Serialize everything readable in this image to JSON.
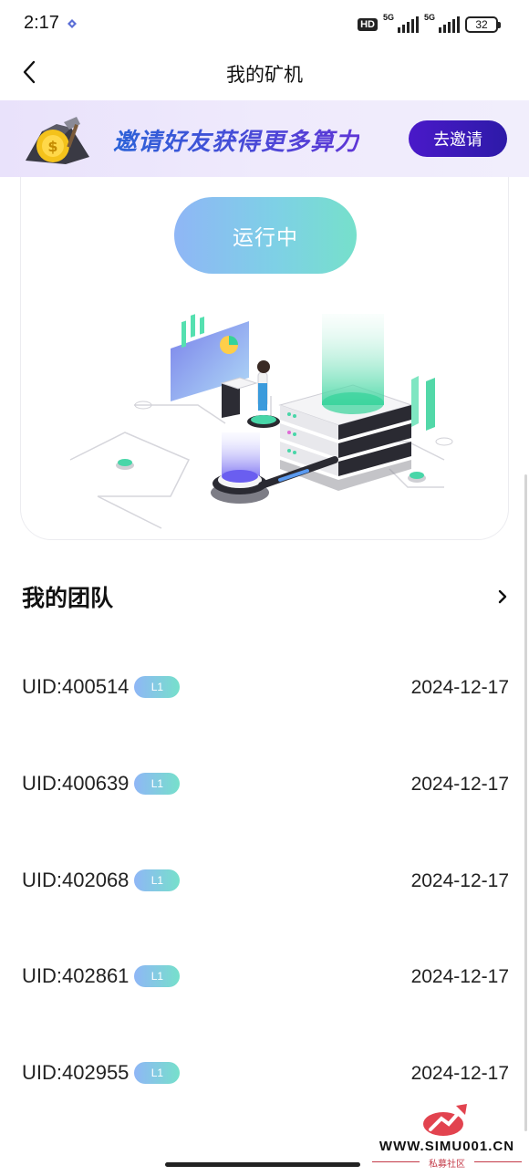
{
  "status_bar": {
    "time": "2:17",
    "hd_label": "HD",
    "network_1": "5G",
    "network_2": "5G",
    "battery": "32"
  },
  "nav": {
    "title": "我的矿机",
    "back_icon": "chevron-left-icon"
  },
  "banner": {
    "text": "邀请好友获得更多算力",
    "button_label": "去邀请",
    "colors": {
      "text": "#3b3ad6",
      "button": "#3a1bbd"
    }
  },
  "miner": {
    "status_label": "运行中",
    "status_color": "#7ed0e6"
  },
  "team": {
    "title": "我的团队",
    "arrow_icon": "chevron-right-icon",
    "members": [
      {
        "uid": "UID:400514",
        "level": "L1",
        "date": "2024-12-17"
      },
      {
        "uid": "UID:400639",
        "level": "L1",
        "date": "2024-12-17"
      },
      {
        "uid": "UID:402068",
        "level": "L1",
        "date": "2024-12-17"
      },
      {
        "uid": "UID:402861",
        "level": "L1",
        "date": "2024-12-17"
      },
      {
        "uid": "UID:402955",
        "level": "L1",
        "date": "2024-12-17"
      }
    ]
  },
  "watermark": {
    "url": "WWW.SIMU001.CN",
    "subtitle": "私募社区"
  }
}
